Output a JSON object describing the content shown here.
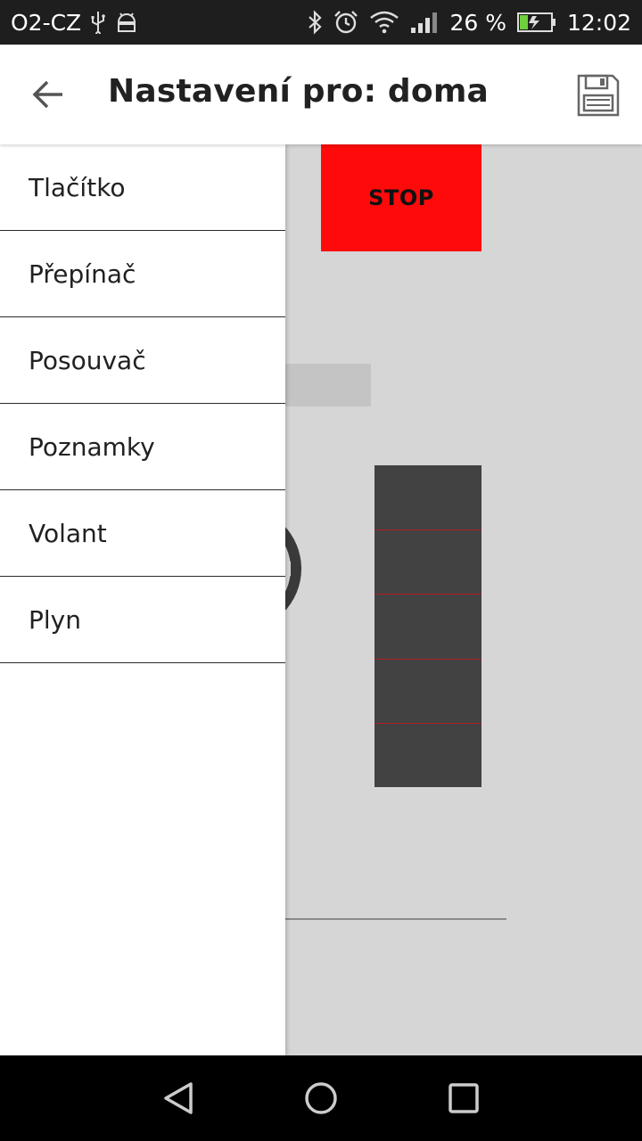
{
  "status_bar": {
    "carrier": "O2-CZ",
    "battery_percent": "26 %",
    "time": "12:02",
    "icons_left": [
      "usb-icon",
      "android-icon"
    ],
    "icons_right": [
      "bluetooth-icon",
      "alarm-icon",
      "wifi-icon",
      "signal-icon",
      "battery-icon"
    ]
  },
  "app_bar": {
    "title": "Nastavení pro: doma",
    "back_icon": "arrow-back-icon",
    "save_icon": "floppy-save-icon"
  },
  "drawer": {
    "items": [
      {
        "label": "Tlačítko"
      },
      {
        "label": "Přepínač"
      },
      {
        "label": "Posouvač"
      },
      {
        "label": "Poznamky"
      },
      {
        "label": "Volant"
      },
      {
        "label": "Plyn"
      }
    ]
  },
  "canvas": {
    "stop_button": {
      "label": "STOP",
      "color": "#ff0a0a"
    },
    "throttle": {
      "color": "#424242",
      "tick_color": "#b02020",
      "segments": 5
    }
  },
  "colors": {
    "status_bar_bg": "#1e1e1e",
    "canvas_bg": "#d6d6d6",
    "nav_bar_bg": "#000000"
  },
  "nav_bar": {
    "buttons": [
      "back-triangle-icon",
      "home-circle-icon",
      "recents-square-icon"
    ]
  }
}
